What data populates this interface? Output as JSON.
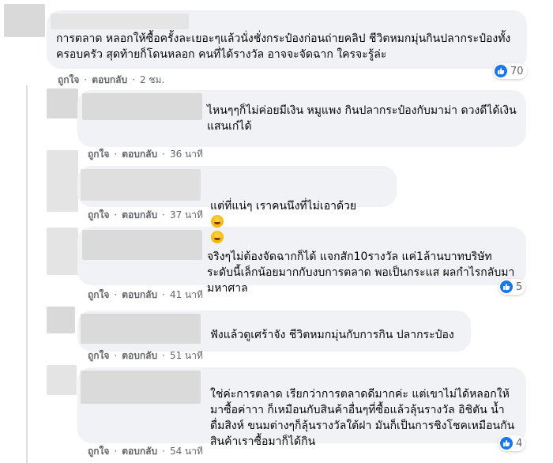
{
  "comments": [
    {
      "text": "การตลาด หลอกให้ซื้อครั้งละเยอะๆแล้วนั่งชั่งกระป๋องก่อนถ่ายคลิป ชีวิตหมกมุ่นกินปลากระป๋องทั้งครอบครัว สุดท้ายก็โดนหลอก คนที่ได้รางวัล อาจจะจัดฉาก ใครจะรู้ล่ะ",
      "like": "ถูกใจ",
      "reply": "ตอบกลับ",
      "time": "2 ชม.",
      "reactions": "70"
    },
    {
      "text": "ไหนๆๆก็ไม่ค่อยมีเงิน หมูแพง กินปลากระป๋องกับมาม่า ดวงดีได้เงินแสนเก๋ได้",
      "like": "ถูกใจ",
      "reply": "ตอบกลับ",
      "time": "36 นาที"
    },
    {
      "text": "แต่ที่แน่ๆ เราคนนึงที่ไม่เอาด้วย",
      "like": "ถูกใจ",
      "reply": "ตอบกลับ",
      "time": "37 นาที"
    },
    {
      "text": "จริงๆไม่ต้องจัดฉากก็ได้ แจกสัก10รางวัล แค่1ล้านบาทบริษัทระดับนี้เล็กน้อยมากกับงบการตลาด พอเป็นกระแส ผลกำไรกลับมามหาศาล",
      "like": "ถูกใจ",
      "reply": "ตอบกลับ",
      "time": "41 นาที",
      "reactions": "5"
    },
    {
      "text": "ฟังแล้วดูเศร้าจัง ชีวิตหมกมุ่นกับการกิน ปลากระป๋อง",
      "like": "ถูกใจ",
      "reply": "ตอบกลับ",
      "time": "51 นาที"
    },
    {
      "text": "ใช่ค่ะการตลาด เรียกว่าการตลาดดีมากค่ะ แต่เขาไม่ได้หลอกให้มาซื้อค่าาา ก็เหมือนกับสินค้าอื่นๆที่ซื้อแล้วลุ้นรางวัล อิชิตัน น้ำดื่มสิงห์ ขนมต่างๆก็ลุ้นรางวัลใต้ฝา มันก็เป็นการชิงโชคเหมือนกัน สินค้าเราซื้อมาก็ได้กิน",
      "like": "ถูกใจ",
      "reply": "ตอบกลับ",
      "time": "54 นาที",
      "reactions": "4"
    }
  ],
  "colors": {
    "bubble": "#f0f2f5",
    "like_blue": "#1877f2",
    "meta_gray": "#65676b"
  },
  "icons": {
    "like": "like-icon",
    "emoji": "laughing-emoji"
  }
}
